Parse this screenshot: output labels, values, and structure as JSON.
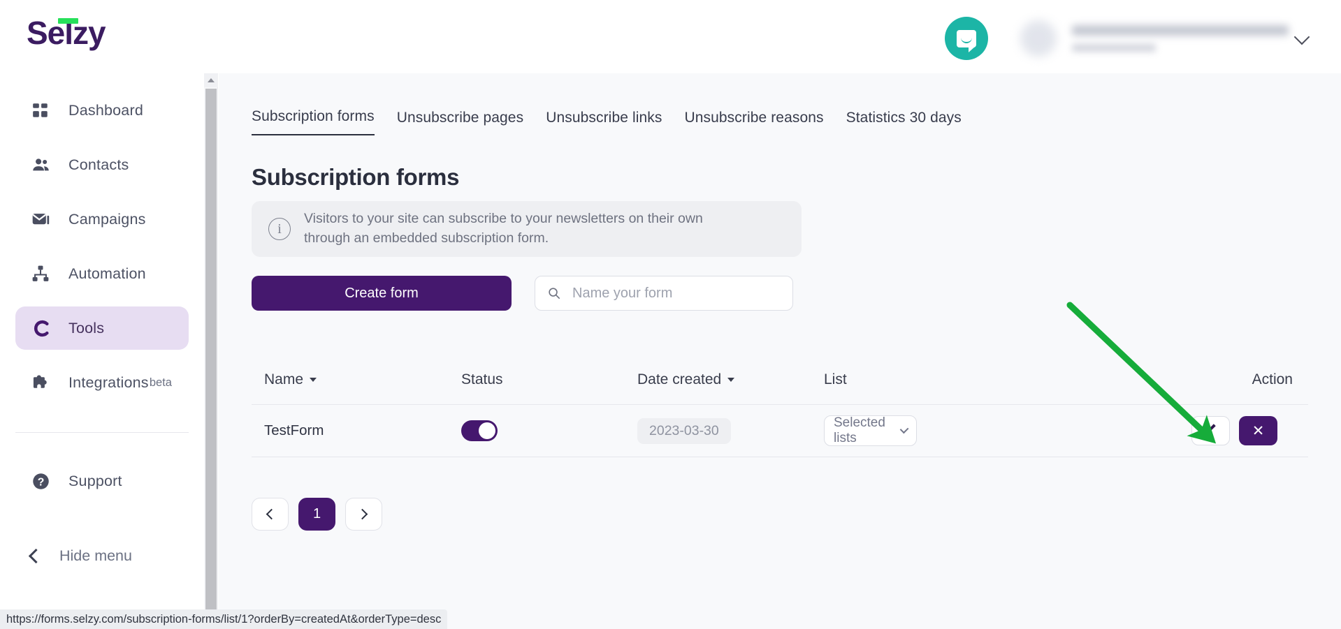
{
  "brand": {
    "logo_text": "Selzy",
    "logo_color": "#3b1c61",
    "accent_color": "#27e05a"
  },
  "topbar": {
    "chat_icon": "chat-bubble-icon",
    "account_chevron_icon": "chevron-down-icon"
  },
  "sidebar": {
    "items": [
      {
        "label": "Dashboard",
        "icon": "grid-icon",
        "active": false
      },
      {
        "label": "Contacts",
        "icon": "people-icon",
        "active": false
      },
      {
        "label": "Campaigns",
        "icon": "envelope-icon",
        "active": false
      },
      {
        "label": "Automation",
        "icon": "sitemap-icon",
        "active": false
      },
      {
        "label": "Tools",
        "icon": "tools-icon",
        "active": true
      },
      {
        "label": "Integrations",
        "icon": "puzzle-icon",
        "active": false,
        "badge": "beta"
      },
      {
        "label": "Support",
        "icon": "question-icon",
        "active": false
      }
    ],
    "hide_menu_label": "Hide menu",
    "hide_menu_icon": "chevron-left-icon"
  },
  "tabs": [
    {
      "label": "Subscription forms",
      "active": true
    },
    {
      "label": "Unsubscribe pages",
      "active": false
    },
    {
      "label": "Unsubscribe links",
      "active": false
    },
    {
      "label": "Unsubscribe reasons",
      "active": false
    },
    {
      "label": "Statistics 30 days",
      "active": false
    }
  ],
  "main": {
    "page_title": "Subscription forms",
    "info_banner": {
      "icon": "info-icon",
      "text": "Visitors to your site can subscribe to your newsletters on their own through an embedded subscription form."
    },
    "create_button": "Create form",
    "search": {
      "placeholder": "Name your form",
      "value": "",
      "icon": "search-icon"
    },
    "table": {
      "headers": {
        "name": "Name",
        "status": "Status",
        "date_created": "Date created",
        "list": "List",
        "action": "Action"
      },
      "rows": [
        {
          "name": "TestForm",
          "status_enabled": true,
          "date_created": "2023-03-30",
          "list_label": "Selected lists",
          "edit_icon": "pencil-icon",
          "delete_icon": "close-icon"
        }
      ]
    },
    "pagination": {
      "prev_icon": "chevron-left-icon",
      "pages": [
        "1"
      ],
      "current_page": "1",
      "next_icon": "chevron-right-icon"
    }
  },
  "annotation": {
    "arrow_color": "#16ac3a",
    "points_to": "edit-button"
  },
  "statusbar": {
    "url": "https://forms.selzy.com/subscription-forms/list/1?orderBy=createdAt&orderType=desc"
  }
}
